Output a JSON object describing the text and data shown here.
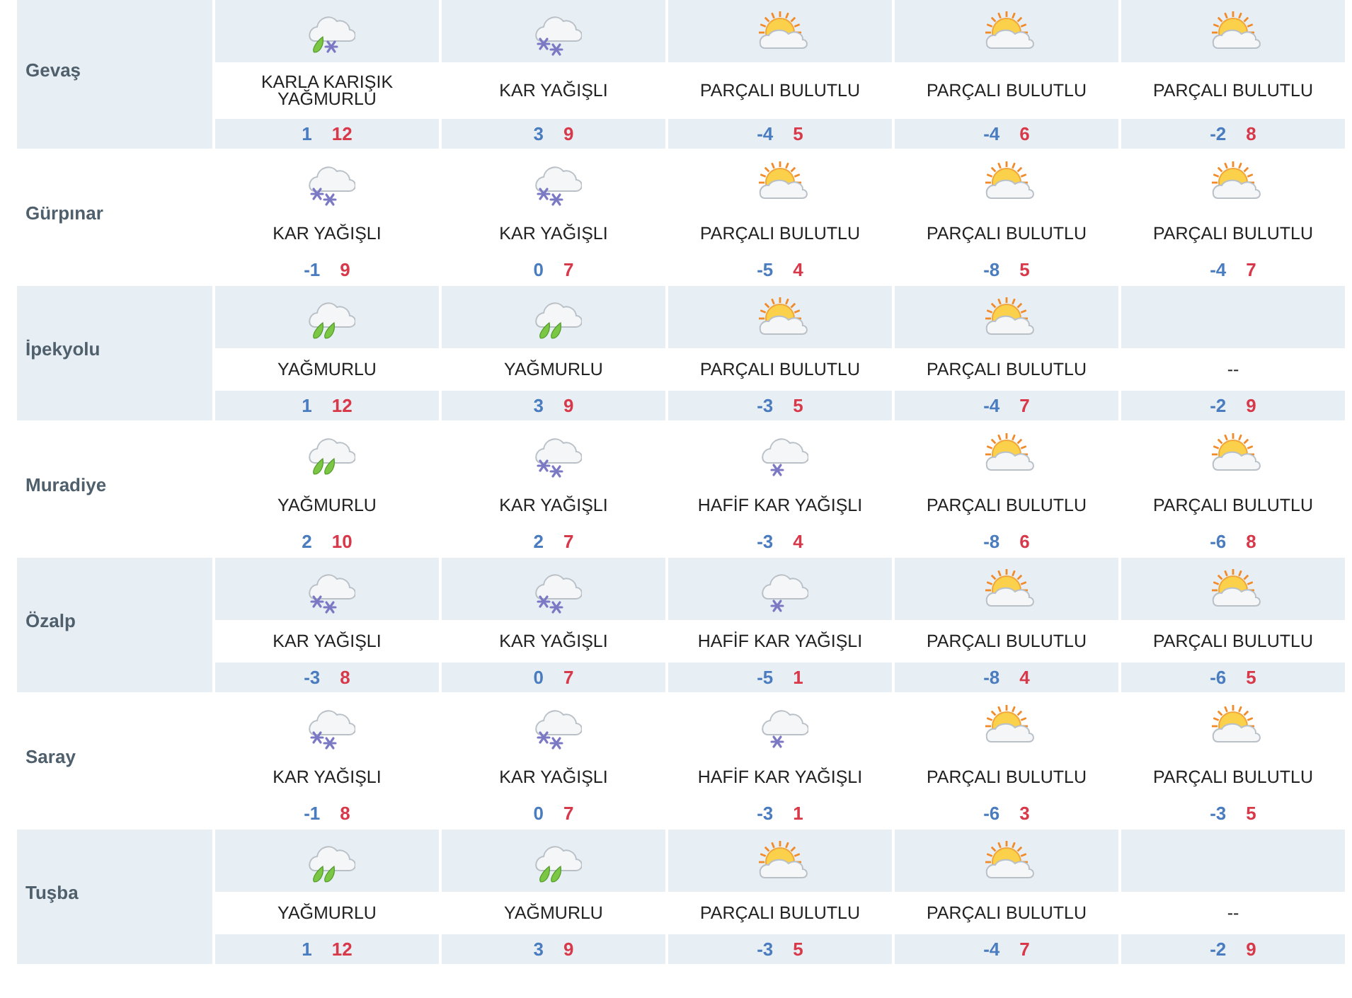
{
  "rows": [
    {
      "name": "Gevaş",
      "days": [
        {
          "kind": "sleet",
          "condition": "KARLA KARIŞIK YAĞMURLU",
          "low": "1",
          "high": "12"
        },
        {
          "kind": "snow",
          "condition": "KAR YAĞIŞLI",
          "low": "3",
          "high": "9"
        },
        {
          "kind": "partly-cloudy",
          "condition": "PARÇALI BULUTLU",
          "low": "-4",
          "high": "5"
        },
        {
          "kind": "partly-cloudy",
          "condition": "PARÇALI BULUTLU",
          "low": "-4",
          "high": "6"
        },
        {
          "kind": "partly-cloudy",
          "condition": "PARÇALI BULUTLU",
          "low": "-2",
          "high": "8"
        }
      ]
    },
    {
      "name": "Gürpınar",
      "days": [
        {
          "kind": "snow",
          "condition": "KAR YAĞIŞLI",
          "low": "-1",
          "high": "9"
        },
        {
          "kind": "snow",
          "condition": "KAR YAĞIŞLI",
          "low": "0",
          "high": "7"
        },
        {
          "kind": "partly-cloudy",
          "condition": "PARÇALI BULUTLU",
          "low": "-5",
          "high": "4"
        },
        {
          "kind": "partly-cloudy",
          "condition": "PARÇALI BULUTLU",
          "low": "-8",
          "high": "5"
        },
        {
          "kind": "partly-cloudy",
          "condition": "PARÇALI BULUTLU",
          "low": "-4",
          "high": "7"
        }
      ]
    },
    {
      "name": "İpekyolu",
      "days": [
        {
          "kind": "rain",
          "condition": "YAĞMURLU",
          "low": "1",
          "high": "12"
        },
        {
          "kind": "rain",
          "condition": "YAĞMURLU",
          "low": "3",
          "high": "9"
        },
        {
          "kind": "partly-cloudy",
          "condition": "PARÇALI BULUTLU",
          "low": "-3",
          "high": "5"
        },
        {
          "kind": "partly-cloudy",
          "condition": "PARÇALI BULUTLU",
          "low": "-4",
          "high": "7"
        },
        {
          "kind": "none",
          "condition": "--",
          "low": "-2",
          "high": "9"
        }
      ]
    },
    {
      "name": "Muradiye",
      "days": [
        {
          "kind": "rain",
          "condition": "YAĞMURLU",
          "low": "2",
          "high": "10"
        },
        {
          "kind": "snow",
          "condition": "KAR YAĞIŞLI",
          "low": "2",
          "high": "7"
        },
        {
          "kind": "light-snow",
          "condition": "HAFİF KAR YAĞIŞLI",
          "low": "-3",
          "high": "4"
        },
        {
          "kind": "partly-cloudy",
          "condition": "PARÇALI BULUTLU",
          "low": "-8",
          "high": "6"
        },
        {
          "kind": "partly-cloudy",
          "condition": "PARÇALI BULUTLU",
          "low": "-6",
          "high": "8"
        }
      ]
    },
    {
      "name": "Özalp",
      "days": [
        {
          "kind": "snow",
          "condition": "KAR YAĞIŞLI",
          "low": "-3",
          "high": "8"
        },
        {
          "kind": "snow",
          "condition": "KAR YAĞIŞLI",
          "low": "0",
          "high": "7"
        },
        {
          "kind": "light-snow",
          "condition": "HAFİF KAR YAĞIŞLI",
          "low": "-5",
          "high": "1"
        },
        {
          "kind": "partly-cloudy",
          "condition": "PARÇALI BULUTLU",
          "low": "-8",
          "high": "4"
        },
        {
          "kind": "partly-cloudy",
          "condition": "PARÇALI BULUTLU",
          "low": "-6",
          "high": "5"
        }
      ]
    },
    {
      "name": "Saray",
      "days": [
        {
          "kind": "snow",
          "condition": "KAR YAĞIŞLI",
          "low": "-1",
          "high": "8"
        },
        {
          "kind": "snow",
          "condition": "KAR YAĞIŞLI",
          "low": "0",
          "high": "7"
        },
        {
          "kind": "light-snow",
          "condition": "HAFİF KAR YAĞIŞLI",
          "low": "-3",
          "high": "1"
        },
        {
          "kind": "partly-cloudy",
          "condition": "PARÇALI BULUTLU",
          "low": "-6",
          "high": "3"
        },
        {
          "kind": "partly-cloudy",
          "condition": "PARÇALI BULUTLU",
          "low": "-3",
          "high": "5"
        }
      ]
    },
    {
      "name": "Tuşba",
      "days": [
        {
          "kind": "rain",
          "condition": "YAĞMURLU",
          "low": "1",
          "high": "12"
        },
        {
          "kind": "rain",
          "condition": "YAĞMURLU",
          "low": "3",
          "high": "9"
        },
        {
          "kind": "partly-cloudy",
          "condition": "PARÇALI BULUTLU",
          "low": "-3",
          "high": "5"
        },
        {
          "kind": "partly-cloudy",
          "condition": "PARÇALI BULUTLU",
          "low": "-4",
          "high": "7"
        },
        {
          "kind": "none",
          "condition": "--",
          "low": "-2",
          "high": "9"
        }
      ]
    }
  ]
}
